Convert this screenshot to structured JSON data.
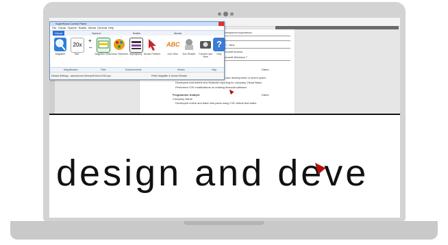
{
  "panel": {
    "title": "SuperNova Control Panel",
    "menu": [
      "File",
      "Visual",
      "Speech",
      "Braille",
      "Media",
      "General",
      "Help"
    ],
    "tabs": [
      "Visual",
      "Speech",
      "Braille",
      "Media"
    ],
    "tools": [
      {
        "label": "Magnifier",
        "icon": "magnifier-icon",
        "color": "#2f7ed8"
      },
      {
        "label": "Size",
        "icon": "size-icon",
        "color": "#ffffff"
      },
      {
        "label": "Magnifier View",
        "icon": "magnifier-view-icon",
        "color": "#2b8f3a"
      },
      {
        "label": "Colour Schemes",
        "icon": "colour-schemes-icon",
        "color": "#e4a11b"
      },
      {
        "label": "Highlighting",
        "icon": "highlighting-icon",
        "color": "#333333"
      },
      {
        "label": "Mouse Pointers",
        "icon": "mouse-pointer-icon",
        "color": "#c62828"
      },
      {
        "label": "Line View",
        "icon": "line-view-icon",
        "color": "#e07b1a"
      },
      {
        "label": "Doc Reader",
        "icon": "doc-reader-icon",
        "color": "#7a7a7a"
      },
      {
        "label": "Connect and View",
        "icon": "camera-icon",
        "color": "#555555"
      },
      {
        "label": "Help",
        "icon": "help-icon",
        "color": "#3a7bd5"
      }
    ],
    "size_value": "20x",
    "groups": [
      "Magnification",
      "Filter",
      "Enhancements",
      "Modes",
      "Help"
    ],
    "status_left": "Default Settings - winword.exe Microsoft Word 2016.sys",
    "status_right": "Prefix Magnifier & Screen Reader"
  },
  "document": {
    "lines": [
      "development experience.",
      "C++, Java",
      "Microsoft Access",
      "Microsoft Windows 7",
      "Programmer Analyst",
      "Company Name",
      "Releases impersonated computer design and development or seven years.",
      "Developed and tested new financial reporting for company Visual Basic.",
      "Performed Y2K modifications on existing financial software.",
      "Programmer Analyst",
      "Company Name",
      "Developed online and batch test plans using Y2K critical test dates."
    ],
    "dates_label": "Dates"
  },
  "magnified_text": "design and deve"
}
